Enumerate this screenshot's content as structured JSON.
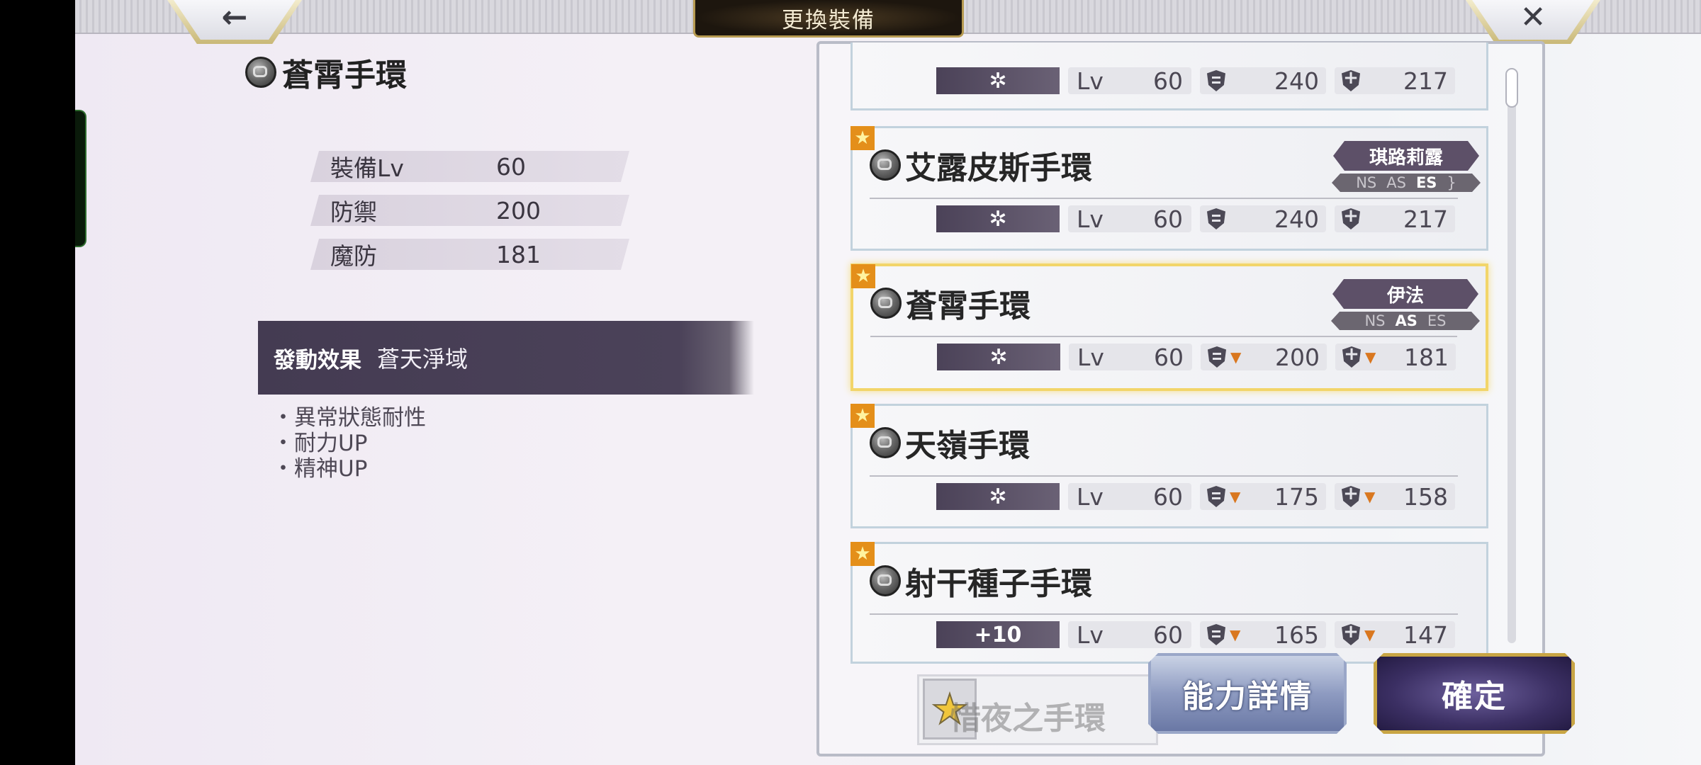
{
  "header": {
    "title": "更換裝備",
    "back_icon": "←",
    "close_icon": "✕"
  },
  "detail": {
    "name": "蒼霄手環",
    "stats": [
      {
        "label": "裝備Lv",
        "value": "60"
      },
      {
        "label": "防禦",
        "value": "200"
      },
      {
        "label": "魔防",
        "value": "181"
      }
    ],
    "effect_label": "發動效果",
    "effect_name": "蒼天淨域",
    "effect_items": [
      "異常狀態耐性",
      "耐力UP",
      "精神UP"
    ]
  },
  "list": {
    "items": [
      {
        "name": "",
        "skill": "✲",
        "lv_label": "Lv",
        "lv": "60",
        "def": "240",
        "mdef": "217",
        "def_down": false,
        "mdef_down": false
      },
      {
        "name": "艾露皮斯手環",
        "character": "琪路莉露",
        "types": [
          "NS",
          "AS",
          "ES"
        ],
        "active_type": "ES",
        "skill": "✲",
        "lv_label": "Lv",
        "lv": "60",
        "def": "240",
        "mdef": "217",
        "def_down": false,
        "mdef_down": false
      },
      {
        "name": "蒼霄手環",
        "character": "伊法",
        "types": [
          "NS",
          "AS",
          "ES"
        ],
        "active_type": "AS",
        "selected": true,
        "skill": "✲",
        "lv_label": "Lv",
        "lv": "60",
        "def": "200",
        "mdef": "181",
        "def_down": true,
        "mdef_down": true
      },
      {
        "name": "天嶺手環",
        "skill": "✲",
        "lv_label": "Lv",
        "lv": "60",
        "def": "175",
        "mdef": "158",
        "def_down": true,
        "mdef_down": true
      },
      {
        "name": "射干種子手環",
        "skill": "+10",
        "lv_label": "Lv",
        "lv": "60",
        "def": "165",
        "mdef": "147",
        "def_down": true,
        "mdef_down": true
      }
    ],
    "partial_item": "惜夜之手環"
  },
  "buttons": {
    "detail": "能力詳情",
    "confirm": "確定"
  },
  "icons": {
    "favorite": "★",
    "badge": "★"
  },
  "colors": {
    "accent_gold": "#f2d56a",
    "panel_purple": "#443b52",
    "down_arrow": "#d9771f"
  }
}
